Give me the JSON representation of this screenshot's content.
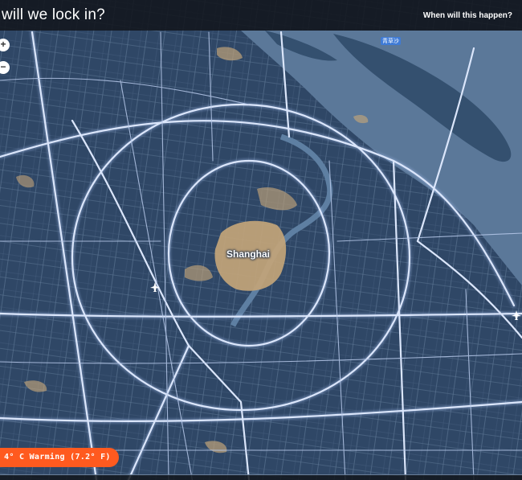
{
  "header": {
    "headline": "will we lock in?",
    "when_link": "When will this happen?"
  },
  "controls": {
    "zoom_in_icon": "+",
    "zoom_out_icon": "−"
  },
  "map": {
    "city_label": "Shanghai",
    "island_label": "青草沙",
    "colors": {
      "land": "#2f4766",
      "water": "#5b7899",
      "road": "#c9d8f3",
      "flooded": "#c4a57a"
    }
  },
  "scenario": {
    "warming_label": "4° C Warming (7.2° F)",
    "accent": "#ff5a1f"
  }
}
